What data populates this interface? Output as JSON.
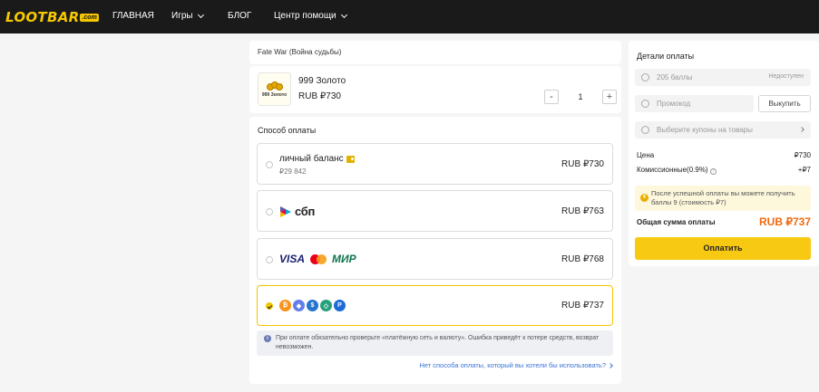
{
  "header": {
    "logo": "LOOTBAR",
    "logo_suffix": ".com",
    "nav": [
      {
        "label": "ГЛАВНАЯ"
      },
      {
        "label": "Игры"
      },
      {
        "label": "БЛОГ"
      },
      {
        "label": "Центр помощи"
      }
    ]
  },
  "product": {
    "game_title": "Fate War (Война судьбы)",
    "thumb_label": "999 Золото",
    "name": "999 Золото",
    "price": "RUB ₽730",
    "quantity": "1",
    "minus": "-",
    "plus": "+"
  },
  "payment": {
    "section_title": "Способ оплаты",
    "methods": [
      {
        "title": "личный баланс",
        "sub": "₽29 842",
        "price": "RUB ₽730",
        "selected": false
      },
      {
        "title": "сбп",
        "price": "RUB ₽763",
        "selected": false
      },
      {
        "visa": "VISA",
        "mir": "МИР",
        "price": "RUB ₽768",
        "selected": false
      },
      {
        "icons": [
          "bitcoin-icon",
          "ethereum-icon",
          "usdc-icon",
          "usdt-icon",
          "paypal-icon"
        ],
        "price": "RUB ₽737",
        "selected": true
      }
    ],
    "note": "При оплате обязательно проверьте «платёжную сеть и валюту». Ошибка приведёт к потере средств, возврат невозможен.",
    "alt_link": "Нет способа оплаты, который вы хотели бы использовать?"
  },
  "details": {
    "title": "Детали оплаты",
    "points_label": "205 баллы",
    "points_status": "Недоступен",
    "promo_placeholder": "Промокод",
    "redeem_label": "Выкупить",
    "coupon_label": "Выберите купоны на товары",
    "price_label": "Цена",
    "price_value": "₽730",
    "fee_label": "Комиссионные(0.9%)",
    "fee_value": "+₽7",
    "reward_text": "После успешной оплаты вы можете получить баллы 9 (стоимость ₽7)",
    "total_label": "Общая сумма оплаты",
    "total_value": "RUB ₽737",
    "pay_label": "Оплатить"
  },
  "colors": {
    "accent": "#f8c912",
    "total": "#f06a0f",
    "link": "#3a74d6"
  }
}
